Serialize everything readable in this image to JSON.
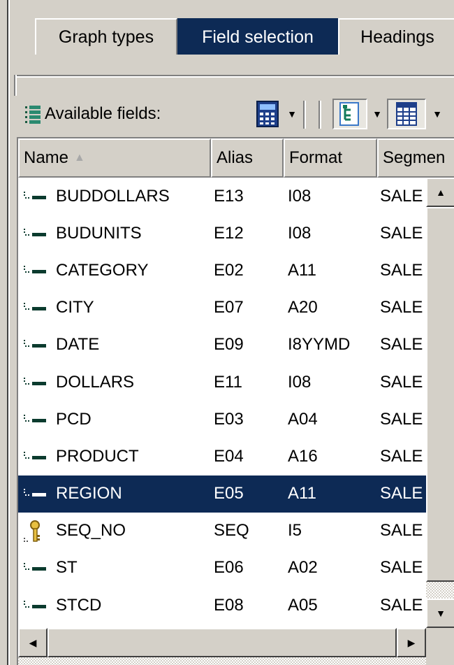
{
  "tabs": [
    {
      "label": "Graph types",
      "active": false
    },
    {
      "label": "Field selection",
      "active": true
    },
    {
      "label": "Headings",
      "active": false
    }
  ],
  "toolbar": {
    "available_label": "Available fields:",
    "icons": [
      "field-list-icon",
      "calculator-icon",
      "tree-view-icon",
      "grid-view-icon"
    ]
  },
  "columns": [
    "Name",
    "Alias",
    "Format",
    "Segmen"
  ],
  "sort": {
    "column": "Name",
    "direction": "ascending"
  },
  "rows": [
    {
      "name": "BUDDOLLARS",
      "alias": "E13",
      "format": "I08",
      "segment": "SALE",
      "icon": "field-icon"
    },
    {
      "name": "BUDUNITS",
      "alias": "E12",
      "format": "I08",
      "segment": "SALE",
      "icon": "field-icon"
    },
    {
      "name": "CATEGORY",
      "alias": "E02",
      "format": "A11",
      "segment": "SALE",
      "icon": "field-icon"
    },
    {
      "name": "CITY",
      "alias": "E07",
      "format": "A20",
      "segment": "SALE",
      "icon": "field-icon"
    },
    {
      "name": "DATE",
      "alias": "E09",
      "format": "I8YYMD",
      "segment": "SALE",
      "icon": "field-icon"
    },
    {
      "name": "DOLLARS",
      "alias": "E11",
      "format": "I08",
      "segment": "SALE",
      "icon": "field-icon"
    },
    {
      "name": "PCD",
      "alias": "E03",
      "format": "A04",
      "segment": "SALE",
      "icon": "field-icon"
    },
    {
      "name": "PRODUCT",
      "alias": "E04",
      "format": "A16",
      "segment": "SALE",
      "icon": "field-icon"
    },
    {
      "name": "REGION",
      "alias": "E05",
      "format": "A11",
      "segment": "SALE",
      "icon": "field-icon",
      "selected": true
    },
    {
      "name": "SEQ_NO",
      "alias": "SEQ",
      "format": "I5",
      "segment": "SALE",
      "icon": "key-icon"
    },
    {
      "name": "ST",
      "alias": "E06",
      "format": "A02",
      "segment": "SALE",
      "icon": "field-icon"
    },
    {
      "name": "STCD",
      "alias": "E08",
      "format": "A05",
      "segment": "SALE",
      "icon": "field-icon"
    }
  ],
  "colors": {
    "selection": "#0d2a55",
    "face": "#d4d0c8",
    "field_icon": "#0b3b2e"
  }
}
